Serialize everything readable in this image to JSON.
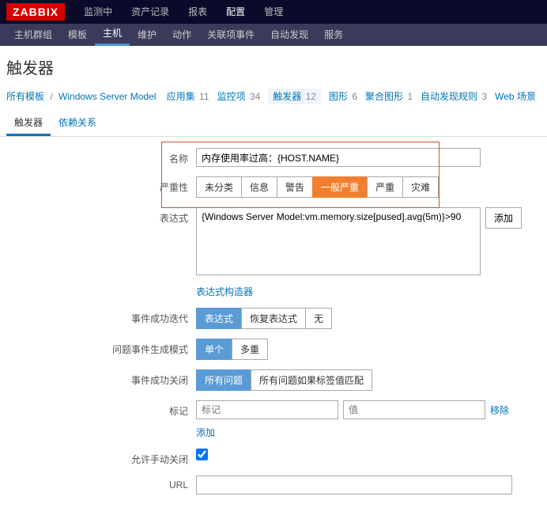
{
  "logo": "ZABBIX",
  "topnav": {
    "items": [
      "监测中",
      "资产记录",
      "报表",
      "配置",
      "管理"
    ],
    "active": 3
  },
  "subnav": {
    "items": [
      "主机群组",
      "模板",
      "主机",
      "维护",
      "动作",
      "关联项事件",
      "自动发现",
      "服务"
    ],
    "active": 2
  },
  "page_title": "触发器",
  "bc": {
    "all": "所有模板",
    "model": "Windows Server Model",
    "items": [
      {
        "label": "应用集",
        "count": "11"
      },
      {
        "label": "监控项",
        "count": "34"
      },
      {
        "label": "触发器",
        "count": "12",
        "current": true
      },
      {
        "label": "图形",
        "count": "6"
      },
      {
        "label": "聚合图形",
        "count": "1"
      },
      {
        "label": "自动发现规则",
        "count": "3"
      },
      {
        "label": "Web 场景",
        "count": ""
      }
    ]
  },
  "tabs": {
    "items": [
      "触发器",
      "依赖关系"
    ],
    "active": 0
  },
  "form": {
    "name_label": "名称",
    "name_value": "内存使用率过高：{HOST.NAME}",
    "severity_label": "严重性",
    "severity_opts": [
      "未分类",
      "信息",
      "警告",
      "一般严重",
      "严重",
      "灾难"
    ],
    "severity_sel": 3,
    "expr_label": "表达式",
    "expr_value": "{Windows Server Model:vm.memory.size[pused].avg(5m)}>90",
    "add_btn": "添加",
    "builder_link": "表达式构造器",
    "ok_iter_label": "事件成功迭代",
    "ok_iter_opts": [
      "表达式",
      "恢复表达式",
      "无"
    ],
    "ok_iter_sel": 0,
    "gen_mode_label": "问题事件生成模式",
    "gen_mode_opts": [
      "单个",
      "多重"
    ],
    "gen_mode_sel": 0,
    "ok_close_label": "事件成功关闭",
    "ok_close_opts": [
      "所有问题",
      "所有问题如果标签值匹配"
    ],
    "ok_close_sel": 0,
    "tags_label": "标记",
    "tag_key_ph": "标记",
    "tag_val_ph": "值",
    "remove_link": "移除",
    "add_link": "添加",
    "manual_close_label": "允许手动关闭",
    "url_label": "URL",
    "url_value": ""
  }
}
